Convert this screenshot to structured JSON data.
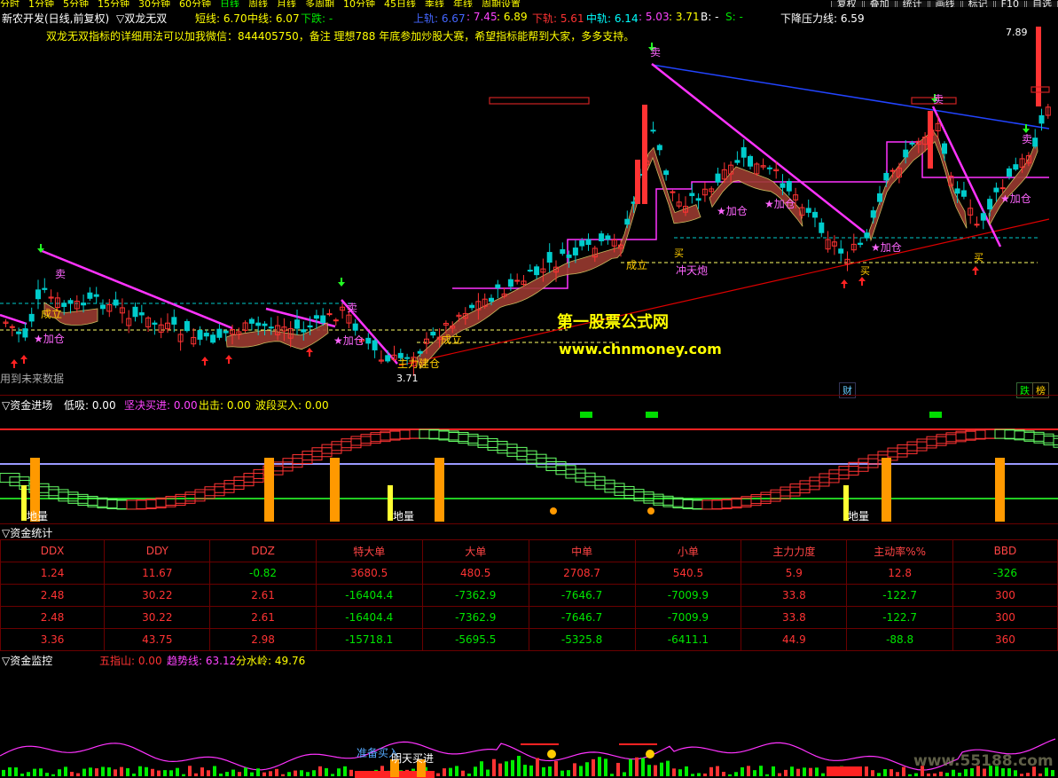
{
  "topbar": {
    "periods": [
      "分时",
      "1分钟",
      "5分钟",
      "15分钟",
      "30分钟",
      "60分钟",
      "日线",
      "周线",
      "月线",
      "多周期",
      "10分钟",
      "45日线",
      "季线",
      "年线",
      "周期设置"
    ],
    "buttons": [
      "复权",
      "叠加",
      "统计",
      "画线",
      "标记",
      "F10",
      "自选"
    ]
  },
  "main_header": {
    "stock_label": "新农开发(日线,前复权)",
    "indicator_name": "▽双龙无双",
    "short_label": "短线: 6.70",
    "mid_label": "中线: 6.07",
    "fall_label": "下跌: -",
    "upper_label": "上轨: 6.67",
    "v1": ": 7.45",
    "v2": ": 6.89",
    "lower_label": "下轨: 5.61",
    "middle_label": "中轨: 6.14",
    "v3": ": 5.03",
    "v4": ": 3.71",
    "b_label": "B: -",
    "s_label": "S: -",
    "pressure_label": "下降压力线: 6.59",
    "notice": "双龙无双指标的详细用法可以加我微信：844405750，备注 理想788 年底参加炒股大赛，希望指标能帮到大家，多多支持。"
  },
  "main_chart": {
    "price_high": "7.89",
    "price_low": "3.71",
    "future_data_note": "用到未来数据",
    "labels": {
      "sell": "卖",
      "buy": "买",
      "add": "★加仓",
      "established": "成立",
      "main_build": "主力建仓",
      "rush": "冲天炮",
      "cai": "财",
      "die": "跌",
      "bang": "榜"
    }
  },
  "watermark": {
    "line1": "第一股票公式网",
    "line2": "www.chnmoney.com",
    "corner": "www.55188.com"
  },
  "panel2": {
    "title": "▽资金进场",
    "low_buy": "低吸: 0.00",
    "firm_buy": "坚决买进: 0.00",
    "out": "出击: 0.00",
    "wave_buy": "波段买入: 0.00",
    "bottom_label": "地量"
  },
  "panel3": {
    "title": "▽资金统计",
    "headers": [
      "DDX",
      "DDY",
      "DDZ",
      "特大单",
      "大单",
      "中单",
      "小单",
      "主力力度",
      "主动率%%",
      "BBD"
    ],
    "rows": [
      [
        {
          "v": "1.24",
          "c": "red"
        },
        {
          "v": "11.67",
          "c": "red"
        },
        {
          "v": "-0.82",
          "c": "green"
        },
        {
          "v": "3680.5",
          "c": "red"
        },
        {
          "v": "480.5",
          "c": "red"
        },
        {
          "v": "2708.7",
          "c": "red"
        },
        {
          "v": "540.5",
          "c": "red"
        },
        {
          "v": "5.9",
          "c": "red"
        },
        {
          "v": "12.8",
          "c": "red"
        },
        {
          "v": "-326",
          "c": "green"
        }
      ],
      [
        {
          "v": "2.48",
          "c": "red"
        },
        {
          "v": "30.22",
          "c": "red"
        },
        {
          "v": "2.61",
          "c": "red"
        },
        {
          "v": "-16404.4",
          "c": "green"
        },
        {
          "v": "-7362.9",
          "c": "green"
        },
        {
          "v": "-7646.7",
          "c": "green"
        },
        {
          "v": "-7009.9",
          "c": "green"
        },
        {
          "v": "33.8",
          "c": "red"
        },
        {
          "v": "-122.7",
          "c": "green"
        },
        {
          "v": "300",
          "c": "red"
        }
      ],
      [
        {
          "v": "2.48",
          "c": "red"
        },
        {
          "v": "30.22",
          "c": "red"
        },
        {
          "v": "2.61",
          "c": "red"
        },
        {
          "v": "-16404.4",
          "c": "green"
        },
        {
          "v": "-7362.9",
          "c": "green"
        },
        {
          "v": "-7646.7",
          "c": "green"
        },
        {
          "v": "-7009.9",
          "c": "green"
        },
        {
          "v": "33.8",
          "c": "red"
        },
        {
          "v": "-122.7",
          "c": "green"
        },
        {
          "v": "300",
          "c": "red"
        }
      ],
      [
        {
          "v": "3.36",
          "c": "red"
        },
        {
          "v": "43.75",
          "c": "red"
        },
        {
          "v": "2.98",
          "c": "red"
        },
        {
          "v": "-15718.1",
          "c": "green"
        },
        {
          "v": "-5695.5",
          "c": "green"
        },
        {
          "v": "-5325.8",
          "c": "green"
        },
        {
          "v": "-6411.1",
          "c": "green"
        },
        {
          "v": "44.9",
          "c": "red"
        },
        {
          "v": "-88.8",
          "c": "green"
        },
        {
          "v": "360",
          "c": "red"
        }
      ]
    ]
  },
  "panel4": {
    "title": "▽资金监控",
    "five_finger": "五指山: 0.00",
    "trend": "趋势线: 63.12",
    "watershed": "分水岭: 49.76",
    "prepare_buy": "准备买入",
    "tomorrow_buy": "明天买进"
  },
  "colors": {
    "up": "#ff3333",
    "down": "#00cccc",
    "ma_magenta": "#ff33ff",
    "resist_blue": "#2244ff",
    "support_red": "#dd0000"
  }
}
